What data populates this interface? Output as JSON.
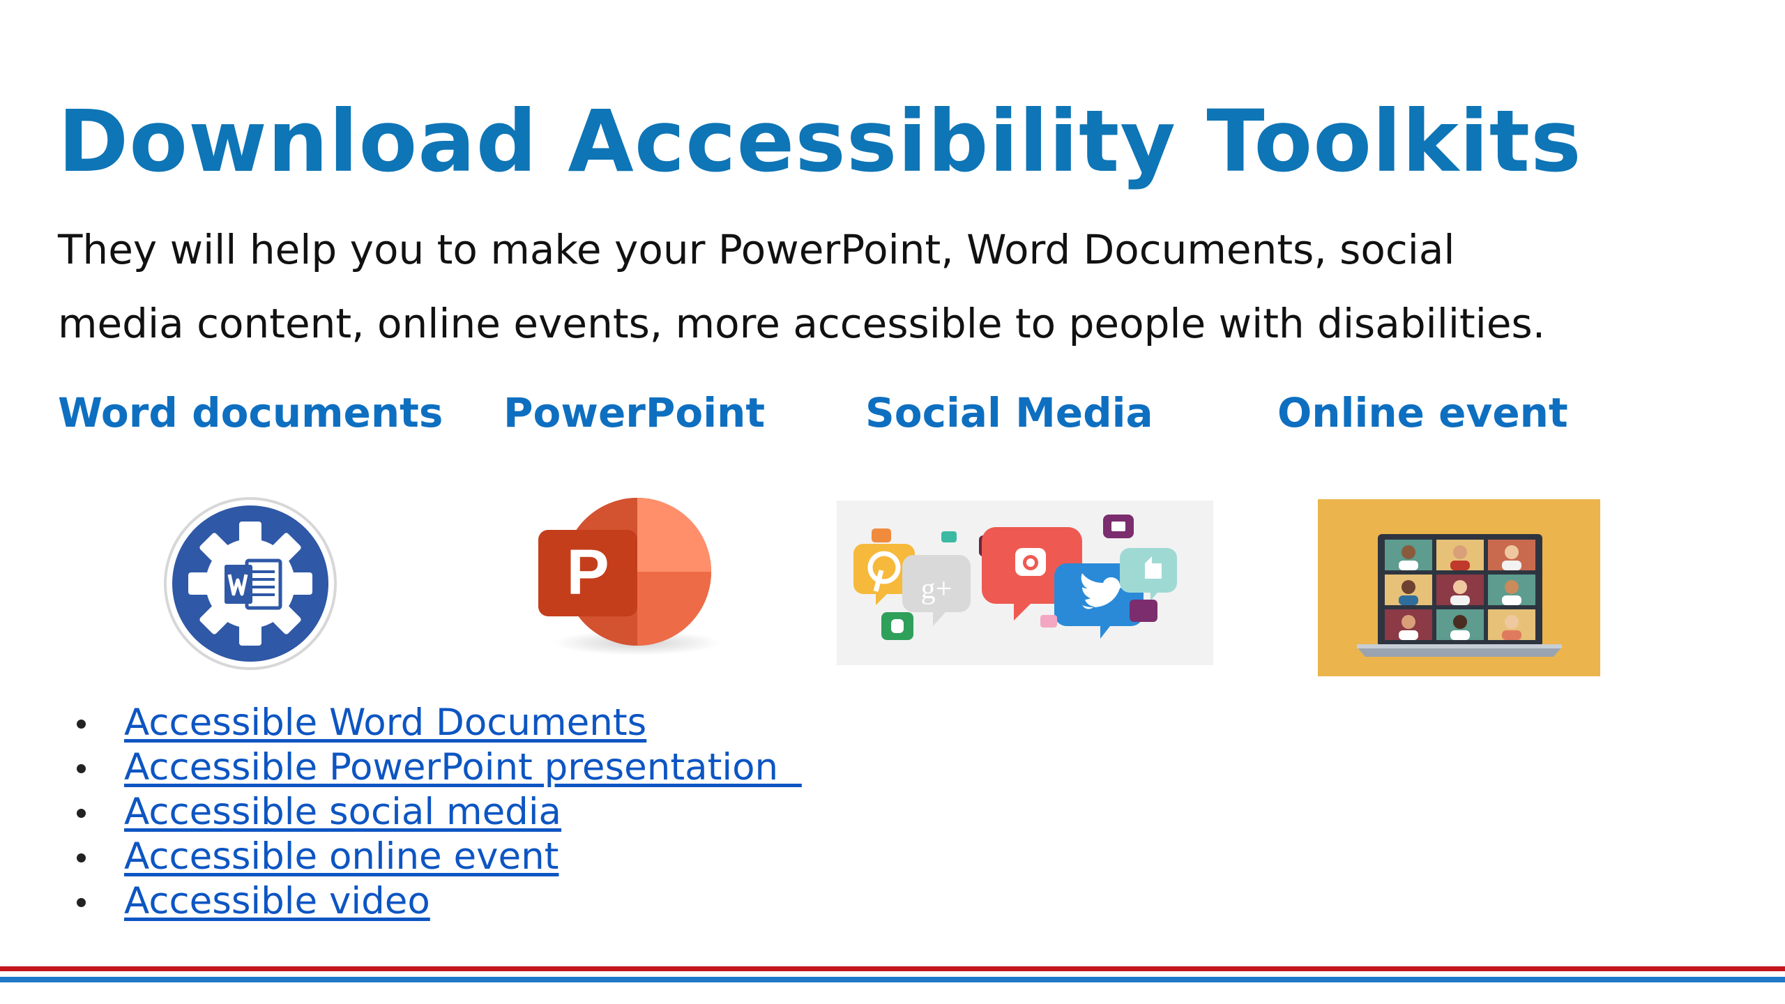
{
  "page": {
    "title": "Download Accessibility Toolkits",
    "intro_line1": "They will help you to make your PowerPoint, Word Documents, social",
    "intro_line2": "media content, online events, more accessible to people with disabilities."
  },
  "categories": [
    {
      "label": "Word documents",
      "icon": "word-gear-icon"
    },
    {
      "label": "PowerPoint",
      "icon": "powerpoint-icon"
    },
    {
      "label": "Social Media",
      "icon": "social-media-bubbles-icon"
    },
    {
      "label": "Online event",
      "icon": "video-conference-laptop-icon"
    }
  ],
  "links": [
    "Accessible Word Documents",
    "Accessible PowerPoint presentation  ",
    "Accessible social media",
    "Accessible online event",
    "Accessible video"
  ],
  "colors": {
    "title": "#0e75b6",
    "heading": "#0e6fc0",
    "link": "#0d55c2",
    "rule_red": "#c4161c",
    "rule_blue": "#1f78c8"
  }
}
